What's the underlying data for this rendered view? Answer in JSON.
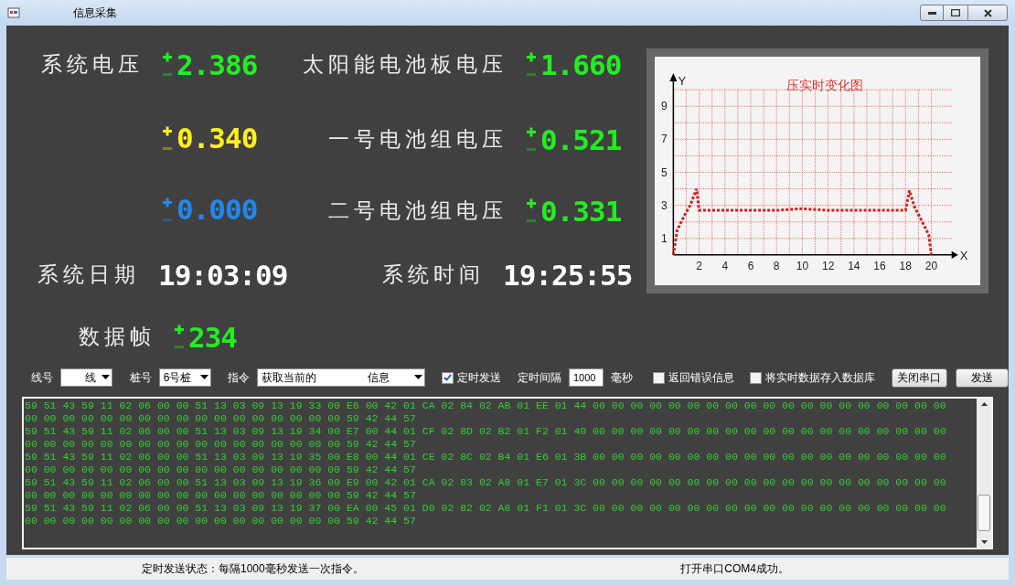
{
  "window": {
    "title": "信息采集"
  },
  "readout_rows": [
    [
      {
        "kind": "signed",
        "label": "系统电压",
        "value": "2.386",
        "color": "#22ee22",
        "positive": true
      },
      {
        "kind": "signed",
        "label": "太阳能电池板电压",
        "value": "1.660",
        "color": "#22ee22",
        "positive": true
      }
    ],
    [
      {
        "kind": "signed",
        "value": "0.340",
        "color": "#ffee22",
        "positive": true
      },
      {
        "kind": "signed",
        "label": "一号电池组电压",
        "value": "0.521",
        "color": "#22ee22",
        "positive": true
      }
    ],
    [
      {
        "kind": "signed",
        "value": "0.000",
        "color": "#2288ee",
        "positive": true
      },
      {
        "kind": "signed",
        "label": "二号电池组电压",
        "value": "0.331",
        "color": "#22ee22",
        "positive": true
      }
    ],
    [
      {
        "kind": "clock",
        "label": "系统日期",
        "value": "19:03:09",
        "color": "#ffffff"
      },
      {
        "kind": "clock",
        "label": "系统时间",
        "value": "19:25:55",
        "color": "#ffffff"
      }
    ],
    [
      {
        "kind": "signed",
        "label": "数据帧",
        "value": "234",
        "color": "#22ee22",
        "positive": true
      }
    ]
  ],
  "chart": {
    "chart_data": {
      "type": "line",
      "title": "压实时变化图",
      "xlabel": "X",
      "ylabel": "Y",
      "x": [
        0,
        0.3,
        0.8,
        1.3,
        1.8,
        2.0,
        4,
        6,
        8,
        10,
        12,
        14,
        16,
        18,
        18.3,
        18.7,
        19.3,
        19.8,
        20
      ],
      "grid": true,
      "series": [
        {
          "color": "#cc2222",
          "line_style": "dashed",
          "values": [
            0,
            1.5,
            2.3,
            3,
            4,
            2.7,
            2.7,
            2.7,
            2.7,
            2.8,
            2.7,
            2.7,
            2.7,
            2.7,
            3.9,
            2.9,
            2,
            1.2,
            0
          ]
        }
      ],
      "xlim": [
        0,
        22
      ],
      "ylim": [
        0,
        10
      ],
      "xticks": [
        2,
        4,
        6,
        8,
        10,
        12,
        14,
        16,
        18,
        20
      ],
      "yticks": [
        1,
        3,
        5,
        7,
        9
      ]
    }
  },
  "controls": {
    "line_label": "线号",
    "line_value": "线",
    "pile_label": "桩号",
    "pile_value": "6号桩",
    "command_label": "指令",
    "command_value_parts": [
      "获取当前的",
      "信息"
    ],
    "timed_send": {
      "label": "定时发送",
      "checked": true
    },
    "interval_label": "定时间隔",
    "interval_value": "1000",
    "interval_unit": "毫秒",
    "return_errors": {
      "label": "返回错误信息",
      "checked": false
    },
    "save_to_db": {
      "label": "将实时数据存入数据库",
      "checked": false
    },
    "buttons": [
      "关闭串口",
      "发送"
    ]
  },
  "log_lines": [
    "59 51 43 59 11 02 06 00 00 51 13 03 09 13 19 33 00 E6 00 42 01 CA 02 84 02 AB 01 EE 01 44 00 00 00 00 00 00 00 00 00 00 00 00 00 00 00 00 00 00 00",
    "00 00 00 00 00 00 00 00 00 00 00 00 00 00 00 00 00 59 42 44 57",
    "59 51 43 59 11 02 06 00 00 51 13 03 09 13 19 34 00 E7 00 44 01 CF 02 8D 02 B2 01 F2 01 40 00 00 00 00 00 00 00 00 00 00 00 00 00 00 00 00 00 00 00",
    "00 00 00 00 00 00 00 00 00 00 00 00 00 00 00 00 00 59 42 44 57",
    "59 51 43 59 11 02 06 00 00 51 13 03 09 13 19 35 00 E8 00 44 01 CE 02 8C 02 B4 01 E6 01 3B 00 00 00 00 00 00 00 00 00 00 00 00 00 00 00 00 00 00 00",
    "00 00 00 00 00 00 00 00 00 00 00 00 00 00 00 00 00 59 42 44 57",
    "59 51 43 59 11 02 06 00 00 51 13 03 09 13 19 36 00 E9 00 42 01 CA 02 83 02 A8 01 E7 01 3C 00 00 00 00 00 00 00 00 00 00 00 00 00 00 00 00 00 00 00",
    "00 00 00 00 00 00 00 00 00 00 00 00 00 00 00 00 00 59 42 44 57",
    "59 51 43 59 11 02 06 00 00 51 13 03 09 13 19 37 00 EA 00 45 01 D0 02 82 02 A8 01 F1 01 3C 00 00 00 00 00 00 00 00 00 00 00 00 00 00 00 00 00 00 00",
    "00 00 00 00 00 00 00 00 00 00 00 00 00 00 00 00 00 59 42 44 57"
  ],
  "status_bar": {
    "left": "定时发送状态：每隔1000毫秒发送一次指令。",
    "right": "打开串口COM4成功。"
  }
}
